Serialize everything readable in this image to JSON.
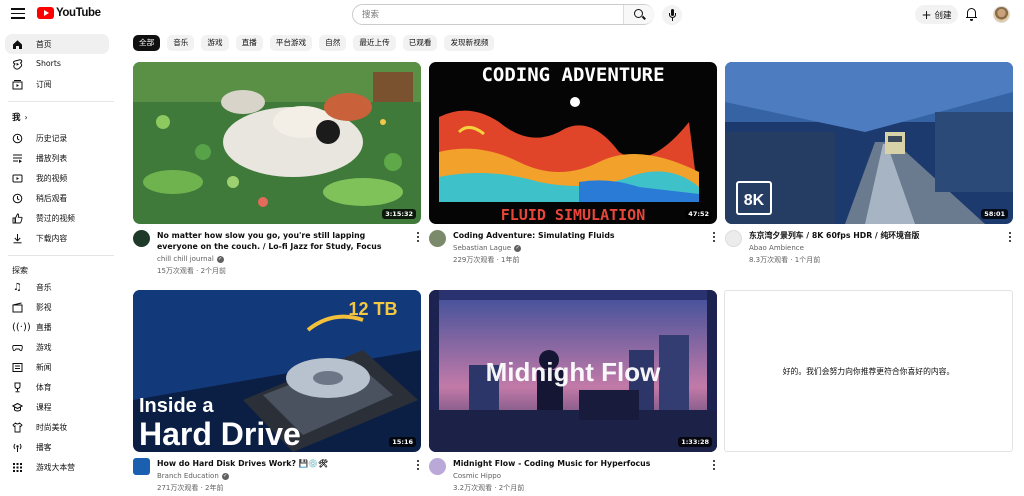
{
  "header": {
    "logo_text": "YouTube",
    "search_placeholder": "搜索",
    "create_label": "创建"
  },
  "sidebar": {
    "main_items": [
      {
        "icon": "home-icon",
        "label": "首页",
        "active": true
      },
      {
        "icon": "shorts-icon",
        "label": "Shorts"
      },
      {
        "icon": "subscriptions-icon",
        "label": "订阅"
      }
    ],
    "you_heading": "我",
    "you_items": [
      {
        "icon": "history-icon",
        "label": "历史记录"
      },
      {
        "icon": "playlists-icon",
        "label": "播放列表"
      },
      {
        "icon": "your-videos-icon",
        "label": "我的视频"
      },
      {
        "icon": "watch-later-icon",
        "label": "稍后观看"
      },
      {
        "icon": "liked-videos-icon",
        "label": "赞过的视频"
      },
      {
        "icon": "downloads-icon",
        "label": "下载内容"
      }
    ],
    "explore_heading": "探索",
    "explore_items": [
      {
        "icon": "music-icon",
        "label": "音乐"
      },
      {
        "icon": "movies-icon",
        "label": "影视"
      },
      {
        "icon": "live-icon",
        "label": "直播"
      },
      {
        "icon": "gaming-icon",
        "label": "游戏"
      },
      {
        "icon": "news-icon",
        "label": "新闻"
      },
      {
        "icon": "sports-icon",
        "label": "体育"
      },
      {
        "icon": "courses-icon",
        "label": "课程"
      },
      {
        "icon": "fashion-icon",
        "label": "时尚美妆"
      },
      {
        "icon": "podcasts-icon",
        "label": "播客"
      },
      {
        "icon": "playables-icon",
        "label": "游戏大本营"
      }
    ]
  },
  "chips": [
    "全部",
    "音乐",
    "游戏",
    "直播",
    "平台游戏",
    "自然",
    "最近上传",
    "已观看",
    "发现新视频"
  ],
  "videos": [
    {
      "title": "No matter how slow you go, you're still lapping everyone on the couch. / Lo-fi Jazz for Study, Focus",
      "channel": "chill chill journal",
      "meta": "15万次观看 · 2个月前",
      "duration": "3:15:32",
      "verified": true
    },
    {
      "title": "Coding Adventure: Simulating Fluids",
      "channel": "Sebastian Lague",
      "meta": "229万次观看 · 1年前",
      "duration": "47:52",
      "verified": true,
      "thumb_top_text": "CODING ADVENTURE",
      "thumb_bottom_text": "FLUID SIMULATION"
    },
    {
      "title": "东京湾夕景列车 / 8K 60fps HDR / 纯环境音版",
      "channel": "Abao Ambience",
      "meta": "8.3万次观看 · 1个月前",
      "duration": "58:01",
      "verified": false,
      "thumb_badge": "8K"
    },
    {
      "title": "How do Hard Disk Drives Work? 💾💿🛠",
      "channel": "Branch Education",
      "meta": "271万次观看 · 2年前",
      "duration": "15:16",
      "verified": true,
      "thumb_badge": "12 TB",
      "thumb_line1": "Inside a",
      "thumb_line2": "Hard Drive"
    },
    {
      "title": "Midnight Flow - Coding Music for Hyperfocus",
      "channel": "Cosmic Hippo",
      "meta": "3.2万次观看 · 2个月前",
      "duration": "1:33:28",
      "verified": false,
      "thumb_text": "Midnight Flow"
    }
  ],
  "empty_message": "好的。我们会努力向你推荐更符合你喜好的内容。"
}
